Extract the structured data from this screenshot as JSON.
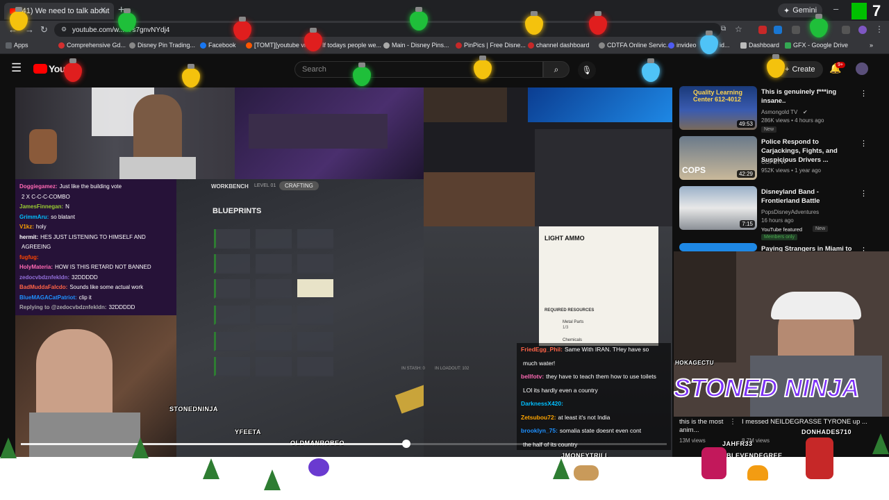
{
  "browser": {
    "tab_title": "(41) We need to talk about",
    "url": "youtube.com/w...=7s7gnvNYdj4",
    "gemini_label": "Gemini",
    "bookmarks": [
      "Apps",
      "Comprehensive Gd...",
      "Disney Pin Trading...",
      "Facebook",
      "[TOMT][youtube vid...",
      "If todays people we...",
      "Main - Disney Pins...",
      "PinPics | Free Disne...",
      "channel dashboard",
      "CDTFA Online Servic...",
      "invideo",
      "id...",
      "Dashboard",
      "GFX - Google Drive"
    ]
  },
  "youtube": {
    "logo_text": "You",
    "search_placeholder": "Search",
    "create_label": "Create",
    "notif_count": "9+"
  },
  "stream": {
    "left_chat": [
      {
        "user": "Doggiegamez:",
        "msg": "Just like the building vote",
        "color": "#ff69b4"
      },
      {
        "user": "",
        "msg": "2 X C-C-C-COMBO",
        "color": "#ffffff"
      },
      {
        "user": "JamesFinnegan:",
        "msg": "N",
        "color": "#9acd32"
      },
      {
        "user": "GrimmAru:",
        "msg": "so blatant",
        "color": "#00bfff"
      },
      {
        "user": "V1kz:",
        "msg": "holy",
        "color": "#ffa500"
      },
      {
        "user": "hermit:",
        "msg": "HES JUST LISTENING TO HIMSELF AND",
        "color": "#ffffff"
      },
      {
        "user": "",
        "msg": "AGREEING",
        "color": "#ffffff"
      },
      {
        "user": "fugfug:",
        "msg": "",
        "color": "#ff4500"
      },
      {
        "user": "HolyMateria:",
        "msg": "HOW IS THIS RETARD NOT BANNED",
        "color": "#ff69b4"
      },
      {
        "user": "zedocvbdznfekldn:",
        "msg": "32DDDDD",
        "color": "#9370db"
      },
      {
        "user": "BadMuddaFalcdo:",
        "msg": "Sounds like some actual work",
        "color": "#ff6347"
      },
      {
        "user": "BlueMAGACatPatriot:",
        "msg": "clip it",
        "color": "#1e90ff"
      },
      {
        "user": "Replying to @zedocvbdznfekldn:",
        "msg": "32DDDDD",
        "color": "#aaaaaa"
      }
    ],
    "workbench": {
      "tab_workbench": "WORKBENCH",
      "tab_level": "LEVEL 01",
      "tab_crafting": "CRAFTING",
      "heading": "BLUEPRINTS"
    },
    "item_panel": {
      "name": "LIGHT AMMO",
      "required_label": "REQUIRED RESOURCES",
      "resource1": "Metal Parts",
      "resource1_qty": "1/3",
      "resource2": "Chemicals",
      "in_stash": "IN STASH: 0",
      "in_loadout": "IN LOADOUT: 102"
    },
    "right_chat": [
      {
        "user": "FriedEgg_Phil:",
        "msg": "Same With IRAN. THey have so",
        "color": "#ff6347"
      },
      {
        "user": "",
        "msg": "much water!",
        "color": "#ffffff"
      },
      {
        "user": "bellfotv:",
        "msg": "they have to teach them how to use toilets",
        "color": "#ff69b4"
      },
      {
        "user": "",
        "msg": "LOl its hardly even a country",
        "color": "#ffffff"
      },
      {
        "user": "DarknessX420:",
        "msg": "",
        "color": "#00bfff"
      },
      {
        "user": "Zetsubou72:",
        "msg": "at least it's not India",
        "color": "#ffa500"
      },
      {
        "user": "brooklyn_75:",
        "msg": "somalia state doesnt even cont",
        "color": "#1e90ff"
      },
      {
        "user": "",
        "msg": "the half of its country",
        "color": "#ffffff"
      }
    ],
    "overlay_names": [
      "STONEDNINJA",
      "YFEETA",
      "OLDMANROBEO",
      "JMONEYTRILL"
    ]
  },
  "recommendations": [
    {
      "title": "This is genuinely f***ing insane..",
      "channel": "Asmongold TV",
      "meta": "286K views • 4 hours ago",
      "badge": "New",
      "duration": "49:53",
      "thumb_text": "Quality Learning Center 612-4012"
    },
    {
      "title": "Police Respond to Carjackings, Fights, and Suspicious Drivers ...",
      "channel": "COPSTV",
      "meta": "952K views • 1 year ago",
      "badge": "",
      "duration": "42:29",
      "thumb_text": "COPS"
    },
    {
      "title": "Disneyland Band - Frontierland Battle",
      "channel": "PopsDisneyAdventures",
      "meta": "16 hours ago",
      "badge": "YouTube featured",
      "badge2": "New",
      "badge3": "Members only",
      "duration": "7:15",
      "thumb_text": ""
    },
    {
      "title": "Paying Strangers in Miami to",
      "channel": "",
      "meta": "",
      "badge": "",
      "duration": "",
      "thumb_text": ""
    }
  ],
  "webcam": {
    "tag": "HOKAGECTU",
    "logo_text": "STONED NINJA"
  },
  "shorts": [
    {
      "title": "this is the most anim...",
      "views": "13M views"
    },
    {
      "title": "I messed NEILDEGRASSE TYRONE up ...",
      "views": "8.7M views"
    }
  ],
  "sprite_names": [
    "JAHFR33",
    "DONHADES710",
    "BLEVENDEGREE"
  ]
}
